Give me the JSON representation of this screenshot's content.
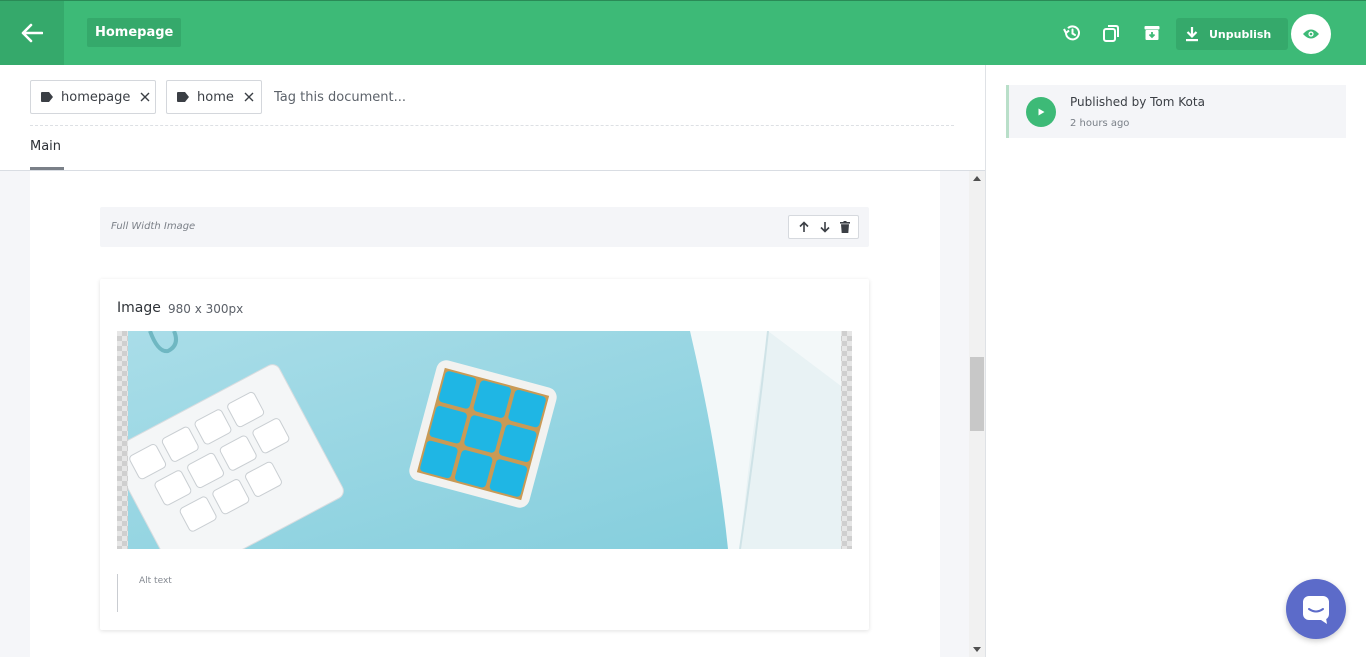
{
  "header": {
    "document_title": "Homepage",
    "unpublish_label": "Unpublish",
    "icons": [
      "back-arrow-icon",
      "history-icon",
      "duplicate-icon",
      "archive-icon",
      "download-icon",
      "eye-icon"
    ]
  },
  "tags": {
    "items": [
      {
        "label": "homepage"
      },
      {
        "label": "home"
      }
    ],
    "input_placeholder": "Tag this document..."
  },
  "tabs": [
    {
      "label": "Main",
      "active": true
    }
  ],
  "slice": {
    "label": "Full Width Image"
  },
  "image_field": {
    "label": "Image",
    "size": "980 x 300px",
    "alt_placeholder": "Alt text"
  },
  "activity": {
    "title": "Published by Tom Kota",
    "time": "2 hours ago"
  },
  "colors": {
    "brand_green": "#3dba77",
    "chat_blue": "#5c6bc9"
  }
}
